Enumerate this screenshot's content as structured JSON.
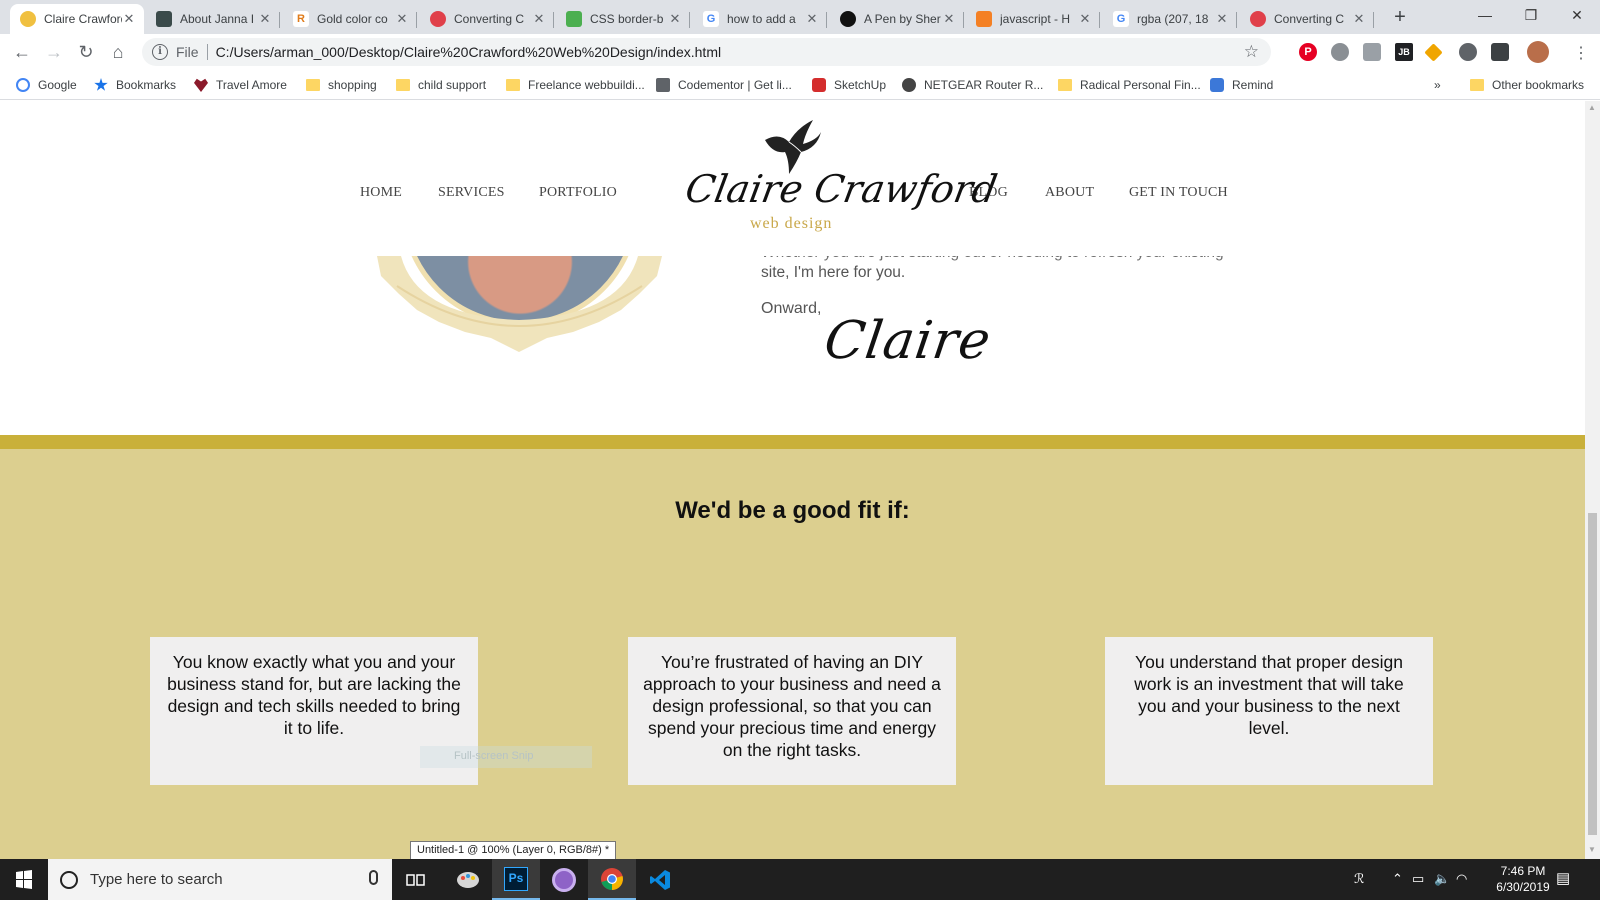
{
  "browser": {
    "tabs": [
      {
        "title": "Claire Crawford",
        "active": true,
        "favicon": "moon-icon",
        "favcolor": "#f0c040"
      },
      {
        "title": "About Janna I",
        "favicon": "image-icon",
        "favcolor": "#3a4a4a"
      },
      {
        "title": "Gold color co",
        "favicon": "r-logo-icon",
        "favcolor": "#e07b1a",
        "glyph": "R"
      },
      {
        "title": "Converting C",
        "favicon": "codementor-icon",
        "favcolor": "#e0404a"
      },
      {
        "title": "CSS border-b",
        "favicon": "w3-icon",
        "favcolor": "#4caf50"
      },
      {
        "title": "how to add a",
        "favicon": "google-icon",
        "favcolor": "#4285f4",
        "glyph": "G"
      },
      {
        "title": "A Pen by Sher",
        "favicon": "codepen-icon",
        "favcolor": "#111111"
      },
      {
        "title": "javascript - H",
        "favicon": "stackoverflow-icon",
        "favcolor": "#f48024"
      },
      {
        "title": "rgba (207, 18",
        "favicon": "google-icon",
        "favcolor": "#4285f4",
        "glyph": "G"
      },
      {
        "title": "Converting C",
        "favicon": "codementor-icon",
        "favcolor": "#e0404a"
      }
    ],
    "close_glyph": "✕",
    "new_tab_glyph": "+",
    "window_controls": {
      "minimize": "—",
      "restore": "❐",
      "close": "✕"
    },
    "nav": {
      "back": "←",
      "forward": "→",
      "reload": "↻",
      "home": "⌂"
    },
    "omnibox": {
      "scheme_label": "File",
      "info_glyph": "i",
      "url": "C:/Users/arman_000/Desktop/Claire%20Crawford%20Web%20Design/index.html",
      "star": "☆"
    },
    "bookmarks": [
      {
        "label": "Google",
        "icon": "google-icon"
      },
      {
        "label": "Bookmarks",
        "icon": "star-icon"
      },
      {
        "label": "Travel Amore",
        "icon": "heart-icon"
      },
      {
        "label": "shopping",
        "icon": "folder-icon"
      },
      {
        "label": "child support",
        "icon": "folder-icon"
      },
      {
        "label": "Freelance webbuildi...",
        "icon": "folder-icon"
      },
      {
        "label": "Codementor | Get li...",
        "icon": "monitor-icon"
      },
      {
        "label": "SketchUp",
        "icon": "sketchup-icon"
      },
      {
        "label": "NETGEAR Router R...",
        "icon": "globe-icon"
      },
      {
        "label": "Radical Personal Fin...",
        "icon": "folder-icon"
      },
      {
        "label": "Remind",
        "icon": "chat-icon"
      }
    ],
    "bookmarks_overflow": "»",
    "other_bookmarks": "Other bookmarks"
  },
  "site": {
    "nav_left": [
      "HOME",
      "SERVICES",
      "PORTFOLIO"
    ],
    "nav_right": [
      "BLOG",
      "ABOUT",
      "GET IN TOUCH"
    ],
    "logo_name": "Claire Crawford",
    "logo_sub": "web design",
    "intro_cut": "Whether you are just starting out or needing to refresh your existing",
    "intro_line": "site, I'm here for you.",
    "signoff": "Onward,",
    "signature": "Claire",
    "fit_heading": "We'd be a good fit if:",
    "cards": [
      "You know exactly what you and your business stand for, but are lacking the design and tech skills needed to bring it to life.",
      "You’re frustrated of having an DIY approach to your business and need a design professional, so that you can spend your precious time and energy on the right tasks.",
      "You understand that proper design work is an investment that will take you and your business to the next level."
    ],
    "colors": {
      "gold_bar": "#c9b03a",
      "gold_section": "#dccf8f",
      "card_bg": "#f0efef",
      "logo_gold": "#c9a84a"
    }
  },
  "overlays": {
    "snip_label": "Full-screen Snip",
    "ps_tooltip": "Untitled-1 @ 100% (Layer 0, RGB/8#) *"
  },
  "taskbar": {
    "search_placeholder": "Type here to search",
    "apps": [
      "task-view-icon",
      "paint-icon",
      "photoshop-icon",
      "purple-app-icon",
      "chrome-icon",
      "vscode-icon"
    ],
    "photoshop_label": "Ps",
    "time": "7:46 PM",
    "date": "6/30/2019"
  }
}
